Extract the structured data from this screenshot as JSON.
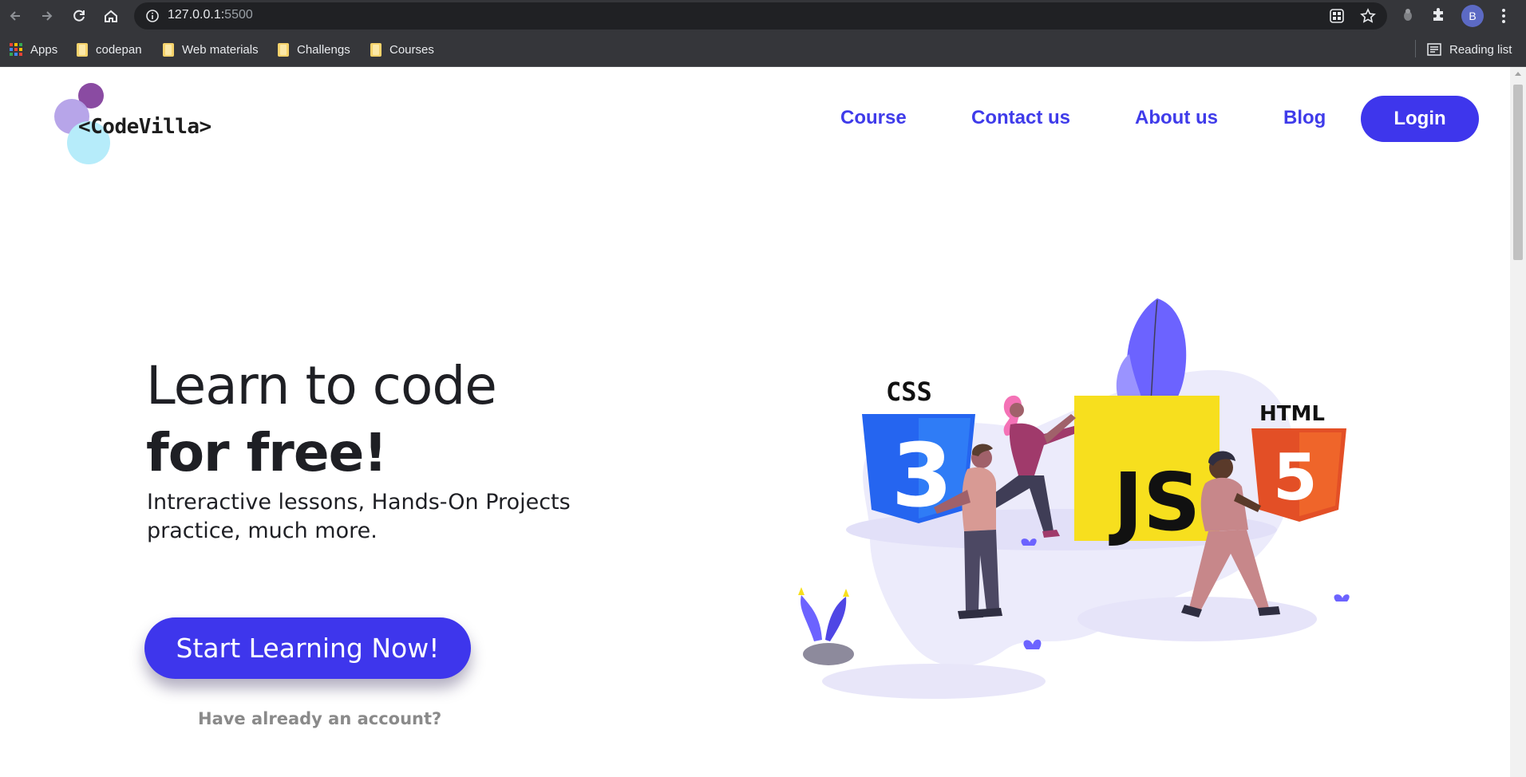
{
  "browser": {
    "url_host": "127.0.0.1:",
    "url_port": "5500",
    "profile_initial": "B",
    "bookmarks": [
      {
        "label": "Apps"
      },
      {
        "label": "codepan"
      },
      {
        "label": "Web materials"
      },
      {
        "label": "Challengs"
      },
      {
        "label": "Courses"
      }
    ],
    "reading_list": "Reading list"
  },
  "site": {
    "logo": "<CodeVilla>",
    "nav": [
      "Course",
      "Contact us",
      "About us",
      "Blog"
    ],
    "login": "Login",
    "hero": {
      "title_line1": "Learn to code",
      "title_line2": "for free!",
      "subtitle": "Intreractive lessons, Hands-On Projects practice, much more.",
      "cta": "Start Learning Now!",
      "secondary": "Have already an account?"
    },
    "illustration": {
      "css": "CSS",
      "js": "JS",
      "html": "HTML"
    }
  },
  "colors": {
    "accent": "#3e36ec",
    "chrome": "#35363a",
    "omnibox": "#202124",
    "text_dark": "#1e1f24",
    "muted": "#8a8a8a"
  }
}
